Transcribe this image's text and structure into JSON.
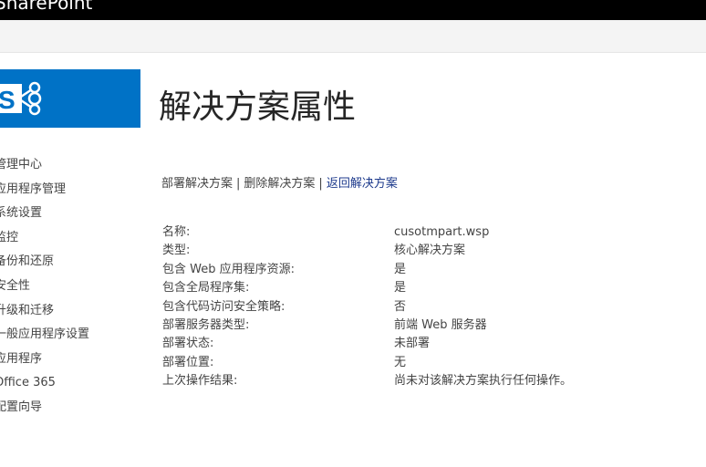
{
  "suitebar": {
    "title": "SharePoint"
  },
  "page": {
    "title": "解决方案属性"
  },
  "logo": {
    "letter": "S",
    "color": "#0072c6"
  },
  "quicklaunch": {
    "items": [
      {
        "label": "管理中心"
      },
      {
        "label": "应用程序管理"
      },
      {
        "label": "系统设置"
      },
      {
        "label": "监控"
      },
      {
        "label": "备份和还原"
      },
      {
        "label": "安全性"
      },
      {
        "label": "升级和迁移"
      },
      {
        "label": "一般应用程序设置"
      },
      {
        "label": "应用程序"
      },
      {
        "label": "Office 365"
      },
      {
        "label": "配置向导"
      }
    ]
  },
  "actions": {
    "deploy": "部署解决方案",
    "remove": "删除解决方案",
    "back": "返回解决方案",
    "separator": "|"
  },
  "properties": [
    {
      "label": "名称:",
      "value": "cusotmpart.wsp"
    },
    {
      "label": "类型:",
      "value": "核心解决方案"
    },
    {
      "label": "包含 Web 应用程序资源:",
      "value": "是"
    },
    {
      "label": "包含全局程序集:",
      "value": "是"
    },
    {
      "label": "包含代码访问安全策略:",
      "value": "否"
    },
    {
      "label": "部署服务器类型:",
      "value": "前端 Web 服务器"
    },
    {
      "label": "部署状态:",
      "value": "未部署"
    },
    {
      "label": "部署位置:",
      "value": "无"
    },
    {
      "label": "上次操作结果:",
      "value": "尚未对该解决方案执行任何操作。"
    }
  ]
}
